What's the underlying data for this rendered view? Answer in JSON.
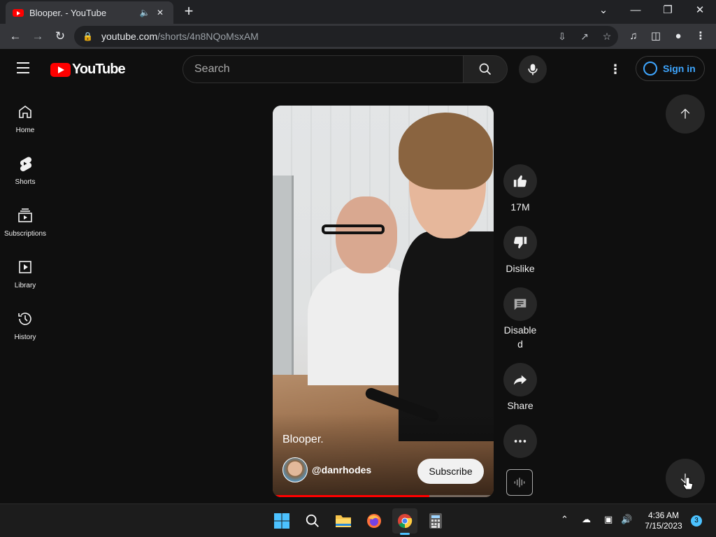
{
  "browser": {
    "tab_title": "Blooper. - YouTube",
    "url_host": "youtube.com",
    "url_path": "/shorts/4n8NQoMsxAM"
  },
  "header": {
    "logo_text": "YouTube",
    "search_placeholder": "Search",
    "sign_in": "Sign in"
  },
  "sidebar": {
    "items": [
      {
        "label": "Home",
        "icon": "home-icon"
      },
      {
        "label": "Shorts",
        "icon": "shorts-icon"
      },
      {
        "label": "Subscriptions",
        "icon": "subscriptions-icon"
      },
      {
        "label": "Library",
        "icon": "library-icon"
      },
      {
        "label": "History",
        "icon": "history-icon"
      }
    ]
  },
  "short": {
    "title": "Blooper.",
    "channel": "@danrhodes",
    "subscribe": "Subscribe",
    "progress": 0.71
  },
  "actions": {
    "likes": "17M",
    "dislike": "Dislike",
    "comments_line1": "Disable",
    "comments_line2": "d",
    "share": "Share"
  },
  "taskbar": {
    "time": "4:36 AM",
    "date": "7/15/2023",
    "notifications": "3"
  },
  "colors": {
    "accent_red": "#ff0000",
    "link_blue": "#3ea6ff",
    "background": "#0f0f0f"
  }
}
